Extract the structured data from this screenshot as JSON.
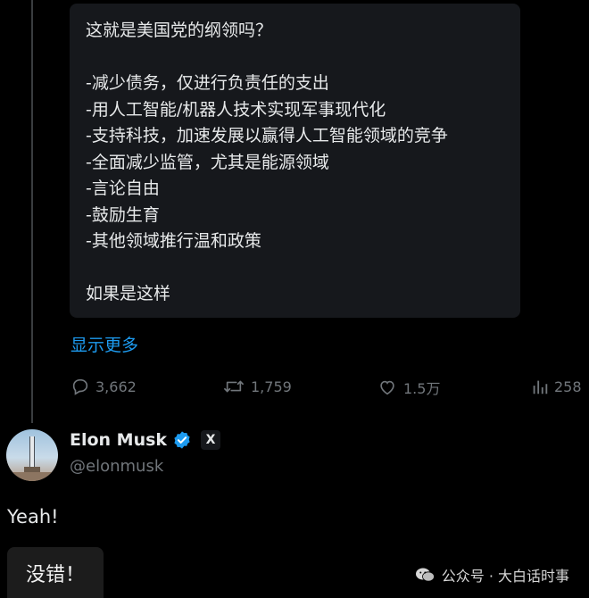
{
  "quote": {
    "lines": [
      "这就是美国党的纲领吗？",
      "",
      "-减少债务，仅进行负责任的支出",
      "-用人工智能/机器人技术实现军事现代化",
      "-支持科技，加速发展以赢得人工智能领域的竞争",
      "-全面减少监管，尤其是能源领域",
      "-言论自由",
      "-鼓励生育",
      "-其他领域推行温和政策",
      "",
      "如果是这样"
    ],
    "show_more": "显示更多"
  },
  "actions": {
    "replies": "3,662",
    "reposts": "1,759",
    "likes": "1.5万",
    "views": "258"
  },
  "reply": {
    "name": "Elon Musk",
    "handle": "@elonmusk",
    "x_label": "X",
    "text": "Yeah!",
    "caption": "没错！"
  },
  "watermark": {
    "text": "公众号 · 大白话时事"
  },
  "colors": {
    "link": "#1d9bf0",
    "verified": "#1d9bf0",
    "muted": "#71767b"
  }
}
